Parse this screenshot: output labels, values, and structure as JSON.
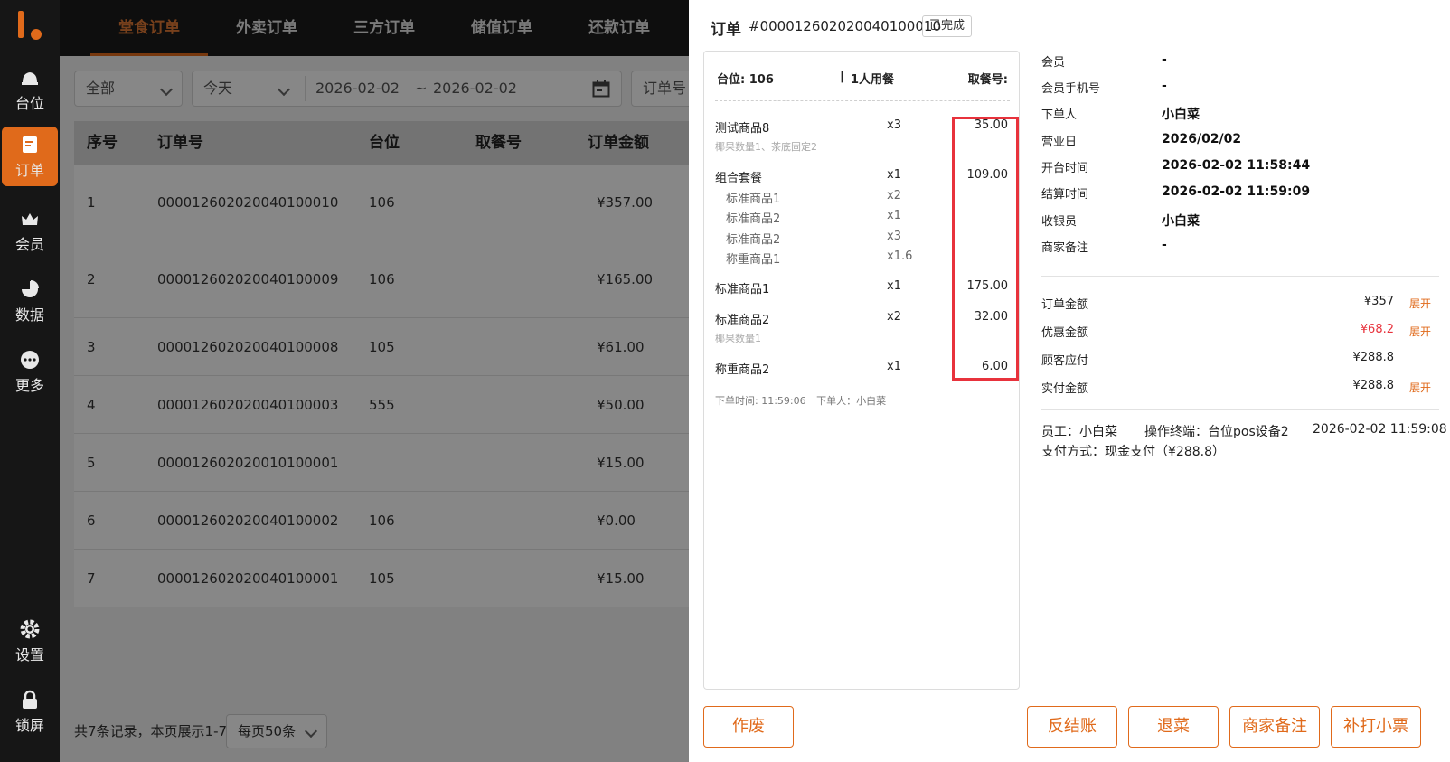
{
  "sidebar": {
    "items": [
      {
        "label": "台位",
        "icon": "bell-icon"
      },
      {
        "label": "订单",
        "icon": "document-icon",
        "active": true
      },
      {
        "label": "会员",
        "icon": "crown-icon"
      },
      {
        "label": "数据",
        "icon": "pie-chart-icon"
      },
      {
        "label": "更多",
        "icon": "more-icon"
      }
    ],
    "bottom": [
      {
        "label": "设置",
        "icon": "gear-icon"
      },
      {
        "label": "锁屏",
        "icon": "lock-icon"
      }
    ]
  },
  "tabs": [
    "堂食订单",
    "外卖订单",
    "三方订单",
    "储值订单",
    "还款订单"
  ],
  "filters": {
    "status": "全部",
    "period": "今天",
    "date_from": "2026-02-02",
    "date_sep": "~",
    "date_to": "2026-02-02",
    "search_type": "订单号"
  },
  "table": {
    "headers": [
      "序号",
      "订单号",
      "台位",
      "取餐号",
      "订单金额"
    ],
    "rows": [
      {
        "idx": "1",
        "order_no": "000012602020040100010",
        "table": "106",
        "pickup": "",
        "amount": "¥357.00"
      },
      {
        "idx": "2",
        "order_no": "000012602020040100009",
        "table": "106",
        "pickup": "",
        "amount": "¥165.00"
      },
      {
        "idx": "3",
        "order_no": "000012602020040100008",
        "table": "105",
        "pickup": "",
        "amount": "¥61.00"
      },
      {
        "idx": "4",
        "order_no": "000012602020040100003",
        "table": "555",
        "pickup": "",
        "amount": "¥50.00"
      },
      {
        "idx": "5",
        "order_no": "000012602020010100001",
        "table": "",
        "pickup": "",
        "amount": "¥15.00"
      },
      {
        "idx": "6",
        "order_no": "000012602020040100002",
        "table": "106",
        "pickup": "",
        "amount": "¥0.00"
      },
      {
        "idx": "7",
        "order_no": "000012602020040100001",
        "table": "105",
        "pickup": "",
        "amount": "¥15.00"
      }
    ]
  },
  "pager": {
    "summary": "共7条记录，本页展示1-7",
    "page_size": "每页50条"
  },
  "drawer": {
    "title": "订单",
    "order_no": "#000012602020040100010",
    "status": "已完成",
    "receipt": {
      "table": "台位: 106",
      "sep": "|",
      "people": "1人用餐",
      "pickup": "取餐号:",
      "items": [
        {
          "name": "测试商品8",
          "qty": "x3",
          "price": "35.00",
          "note": "椰果数量1、茶底固定2"
        },
        {
          "name": "组合套餐",
          "qty": "x1",
          "price": "109.00"
        },
        {
          "name": "标准商品1",
          "qty": "x2",
          "sub": true
        },
        {
          "name": "标准商品2",
          "qty": "x1",
          "sub": true
        },
        {
          "name": "标准商品2",
          "qty": "x3",
          "sub": true
        },
        {
          "name": "称重商品1",
          "qty": "x1.6",
          "sub": true
        },
        {
          "name": "标准商品1",
          "qty": "x1",
          "price": "175.00"
        },
        {
          "name": "标准商品2",
          "qty": "x2",
          "price": "32.00",
          "note": "椰果数量1"
        },
        {
          "name": "称重商品2",
          "qty": "x1",
          "price": "6.00"
        }
      ],
      "footer_time": "下单时间: 11:59:06",
      "footer_user": "下单人：小白菜"
    },
    "info": [
      {
        "label": "会员",
        "value": "-"
      },
      {
        "label": "会员手机号",
        "value": "-"
      },
      {
        "label": "下单人",
        "value": "小白菜"
      },
      {
        "label": "营业日",
        "value": "2026/02/02"
      },
      {
        "label": "开台时间",
        "value": "2026-02-02 11:58:44"
      },
      {
        "label": "结算时间",
        "value": "2026-02-02 11:59:09"
      },
      {
        "label": "收银员",
        "value": "小白菜"
      },
      {
        "label": "商家备注",
        "value": "-"
      }
    ],
    "amounts": [
      {
        "label": "订单金额",
        "value": "¥357",
        "expand": "展开"
      },
      {
        "label": "优惠金额",
        "value": "¥68.2",
        "expand": "展开",
        "red": true
      },
      {
        "label": "顾客应付",
        "value": "¥288.8"
      },
      {
        "label": "实付金额",
        "value": "¥288.8",
        "expand": "展开"
      }
    ],
    "meta": {
      "staff": "员工：小白菜",
      "terminal": "操作终端：台位pos设备2",
      "time": "2026-02-02 11:59:08",
      "payment": "支付方式：现金支付（¥288.8）"
    },
    "buttons": {
      "void": "作废",
      "reverse": "反结账",
      "return": "退菜",
      "note": "商家备注",
      "reprint": "补打小票"
    }
  },
  "colors": {
    "accent": "#e06a1b",
    "highlight": "#e8323c",
    "sidebar_bg": "#161616"
  }
}
